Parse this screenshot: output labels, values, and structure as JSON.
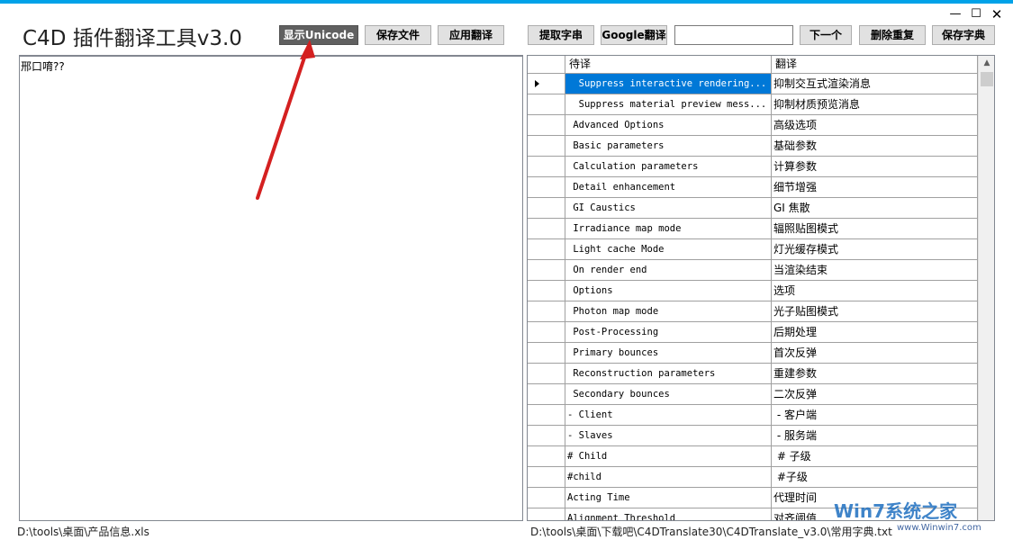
{
  "window": {
    "title": "C4D 插件翻译工具v3.0",
    "min_glyph": "—",
    "max_glyph": "☐",
    "close_glyph": "✕",
    "accent_color": "#00a2e8"
  },
  "toolbar": {
    "show_unicode": "显示Unicode",
    "save_file": "保存文件",
    "apply_translation": "应用翻译",
    "extract_strings": "提取字串",
    "google_translate": "Google翻译",
    "search_value": "",
    "next": "下一个",
    "remove_duplicates": "删除重复",
    "save_dictionary": "保存字典"
  },
  "left_panel": {
    "text": "邢口唷??"
  },
  "grid": {
    "columns": [
      "待译",
      "翻译"
    ],
    "rows": [
      {
        "src": "  Suppress interactive rendering...",
        "tr": "抑制交互式渲染消息",
        "selected": true
      },
      {
        "src": "  Suppress material preview mess...",
        "tr": "抑制材质预览消息",
        "selected": false
      },
      {
        "src": " Advanced Options",
        "tr": "高级选项",
        "selected": false
      },
      {
        "src": " Basic parameters",
        "tr": "基础参数",
        "selected": false
      },
      {
        "src": " Calculation parameters",
        "tr": "计算参数",
        "selected": false
      },
      {
        "src": " Detail enhancement",
        "tr": "细节增强",
        "selected": false
      },
      {
        "src": " GI Caustics",
        "tr": "GI 焦散",
        "selected": false
      },
      {
        "src": " Irradiance map mode",
        "tr": "辐照贴图模式",
        "selected": false
      },
      {
        "src": " Light cache Mode",
        "tr": "灯光缓存模式",
        "selected": false
      },
      {
        "src": " On render end",
        "tr": "当渲染结束",
        "selected": false
      },
      {
        "src": " Options",
        "tr": "选项",
        "selected": false
      },
      {
        "src": " Photon map mode",
        "tr": "光子贴图模式",
        "selected": false
      },
      {
        "src": " Post-Processing",
        "tr": "后期处理",
        "selected": false
      },
      {
        "src": " Primary bounces",
        "tr": "首次反弹",
        "selected": false
      },
      {
        "src": " Reconstruction parameters",
        "tr": "重建参数",
        "selected": false
      },
      {
        "src": " Secondary bounces",
        "tr": "二次反弹",
        "selected": false
      },
      {
        "src": "- Client",
        "tr": " - 客户端",
        "selected": false
      },
      {
        "src": "- Slaves",
        "tr": " - 服务端",
        "selected": false
      },
      {
        "src": "# Child",
        "tr": " # 子级",
        "selected": false
      },
      {
        "src": "#child",
        "tr": " #子级",
        "selected": false
      },
      {
        "src": "Acting Time",
        "tr": "代理时间",
        "selected": false
      },
      {
        "src": "Alignment Threshold",
        "tr": "对齐阈值",
        "selected": false
      }
    ],
    "scroll_up_glyph": "▲"
  },
  "status": {
    "left_path": "D:\\tools\\桌面\\产品信息.xls",
    "right_path": "D:\\tools\\桌面\\下载吧\\C4DTranslate30\\C4DTranslate_v3.0\\常用字典.txt"
  },
  "watermark": {
    "logo_text": "Win7系统之家",
    "url_text": "www.Winwin7.com"
  },
  "annotation": {
    "arrow_color": "#d42020"
  }
}
